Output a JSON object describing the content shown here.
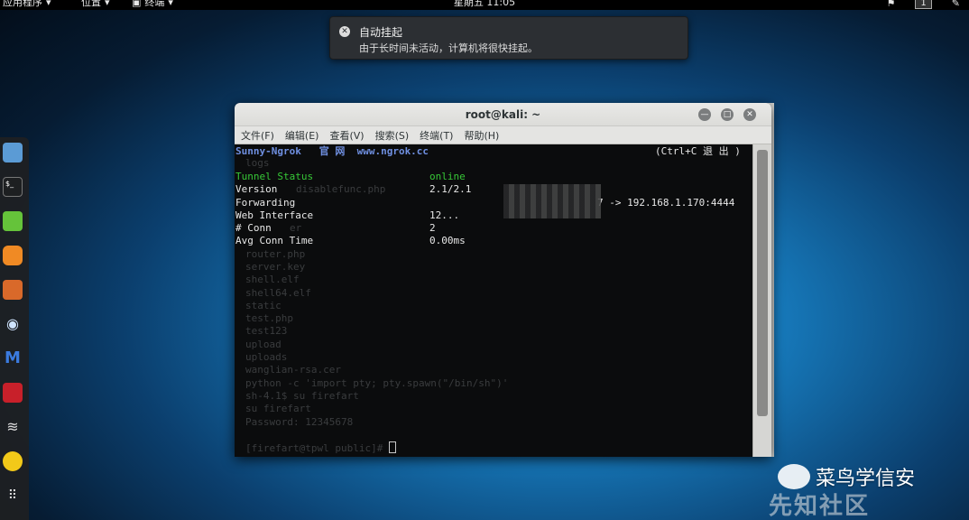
{
  "topbar": {
    "apps_label": "应用程序",
    "places_label": "位置",
    "terminal_label": "终端",
    "clock": "星期五 11:05",
    "workspace": "1"
  },
  "notification": {
    "title": "自动挂起",
    "body": "由于长时间未活动，计算机将很快挂起。"
  },
  "window": {
    "title": "root@kali: ~",
    "menus": [
      "文件(F)",
      "编辑(E)",
      "查看(V)",
      "搜索(S)",
      "终端(T)",
      "帮助(H)"
    ]
  },
  "ngrok": {
    "header_left": "Sunny-Ngrok   官 网  www.ngrok.cc",
    "header_right": "(Ctrl+C 退 出 )",
    "rows": [
      {
        "label": "Tunnel Status",
        "value": "online"
      },
      {
        "label": "Version",
        "value": "2.1/2.1"
      },
      {
        "label": "Forwarding",
        "value": "7 -> 192.168.1.170:4444"
      },
      {
        "label": "Web Interface",
        "value": "12..."
      },
      {
        "label": "# Conn",
        "value": "2"
      },
      {
        "label": "Avg Conn Time",
        "value": "0.00ms"
      }
    ]
  },
  "background_lines": [
    "logs",
    "disablefunc.php",
    "",
    "",
    "er",
    "",
    "router.php",
    "server.key",
    "shell.elf",
    "shell64.elf",
    "static",
    "test.php",
    "test123",
    "upload",
    "uploads",
    "wanglian-rsa.cer",
    "python -c 'import pty; pty.spawn(\"/bin/sh\")'",
    "sh-4.1$ su firefart",
    "su firefart",
    "Password: 12345678",
    "",
    "[firefart@tpwl public]# "
  ],
  "watermark": {
    "brand": "菜鸟学信安",
    "site": "先知社区"
  },
  "colors": {
    "accent_green": "#37c837",
    "header_blue": "#6f8fe0"
  }
}
